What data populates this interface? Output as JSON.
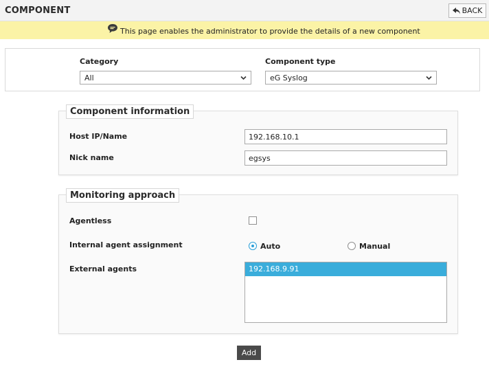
{
  "header": {
    "title": "COMPONENT",
    "back_label": "BACK"
  },
  "info_bar": {
    "icon": "speech-bubble-icon",
    "message": "This page enables the administrator to provide the details of a new component"
  },
  "filters": {
    "category_label": "Category",
    "category_value": "All",
    "component_type_label": "Component type",
    "component_type_value": "eG Syslog"
  },
  "component_information": {
    "legend": "Component information",
    "host_label": "Host IP/Name",
    "host_value": "192.168.10.1",
    "nick_label": "Nick name",
    "nick_value": "egsys"
  },
  "monitoring_approach": {
    "legend": "Monitoring approach",
    "agentless_label": "Agentless",
    "agentless_checked": false,
    "assignment_label": "Internal agent assignment",
    "assignment_options": [
      "Auto",
      "Manual"
    ],
    "assignment_selected": "Auto",
    "external_label": "External agents",
    "external_agents": [
      "192.168.9.91"
    ],
    "external_selected": "192.168.9.91"
  },
  "actions": {
    "add_label": "Add"
  },
  "colors": {
    "info_bar_bg": "#fbf3a6",
    "selection_blue": "#3aaddb",
    "radio_accent": "#2b9fd8",
    "add_button_bg": "#4a4a4a"
  }
}
